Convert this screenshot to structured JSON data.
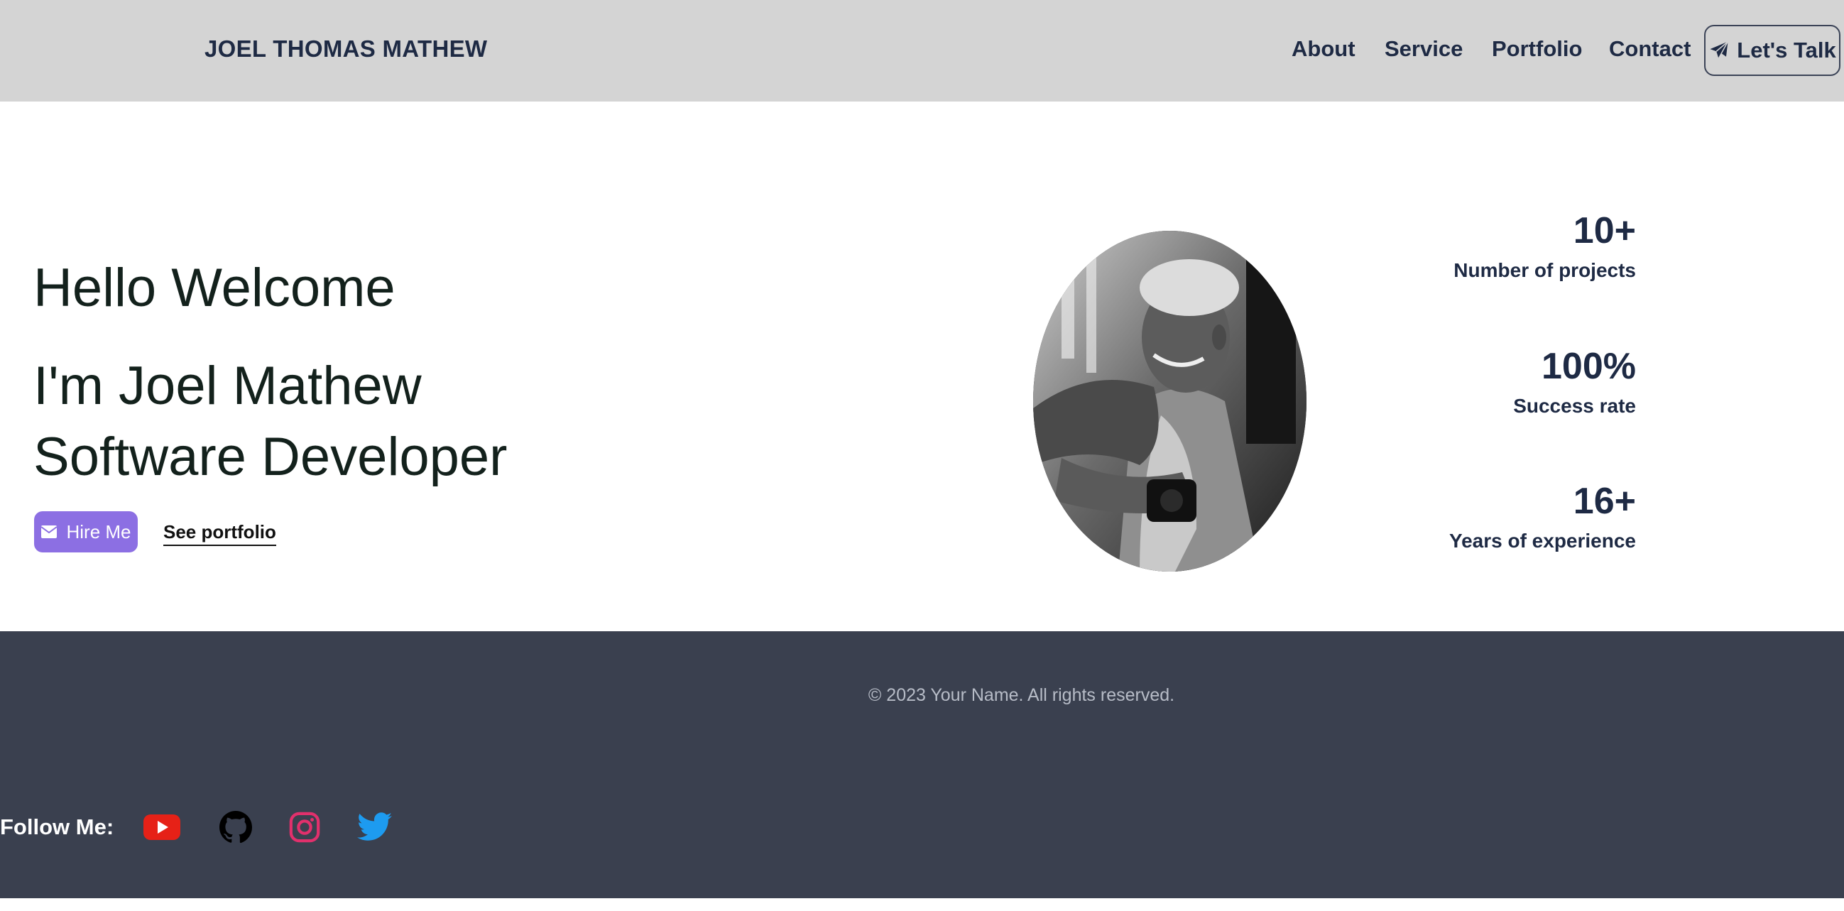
{
  "header": {
    "brand": "JOEL THOMAS MATHEW",
    "nav": [
      "About",
      "Service",
      "Portfolio",
      "Contact"
    ],
    "cta_label": "Let's Talk",
    "cta_icon": "paper-plane-icon"
  },
  "hero": {
    "greeting": "Hello Welcome",
    "intro": "I'm Joel Mathew",
    "role": "Software Developer",
    "hire_label": "Hire Me",
    "hire_icon": "envelope-icon",
    "portfolio_label": "See portfolio",
    "accent_color": "#8c6fe3"
  },
  "stats": [
    {
      "value": "10+",
      "label": "Number of projects"
    },
    {
      "value": "100%",
      "label": "Success rate"
    },
    {
      "value": "16+",
      "label": "Years of experience"
    }
  ],
  "footer": {
    "copyright": "© 2023 Your Name. All rights reserved.",
    "follow_label": "Follow Me:",
    "social": [
      {
        "name": "youtube-icon",
        "color": "#e62117"
      },
      {
        "name": "github-icon",
        "color": "#000000"
      },
      {
        "name": "instagram-icon",
        "color": "#e1306c"
      },
      {
        "name": "twitter-icon",
        "color": "#1d9bf0"
      }
    ]
  }
}
